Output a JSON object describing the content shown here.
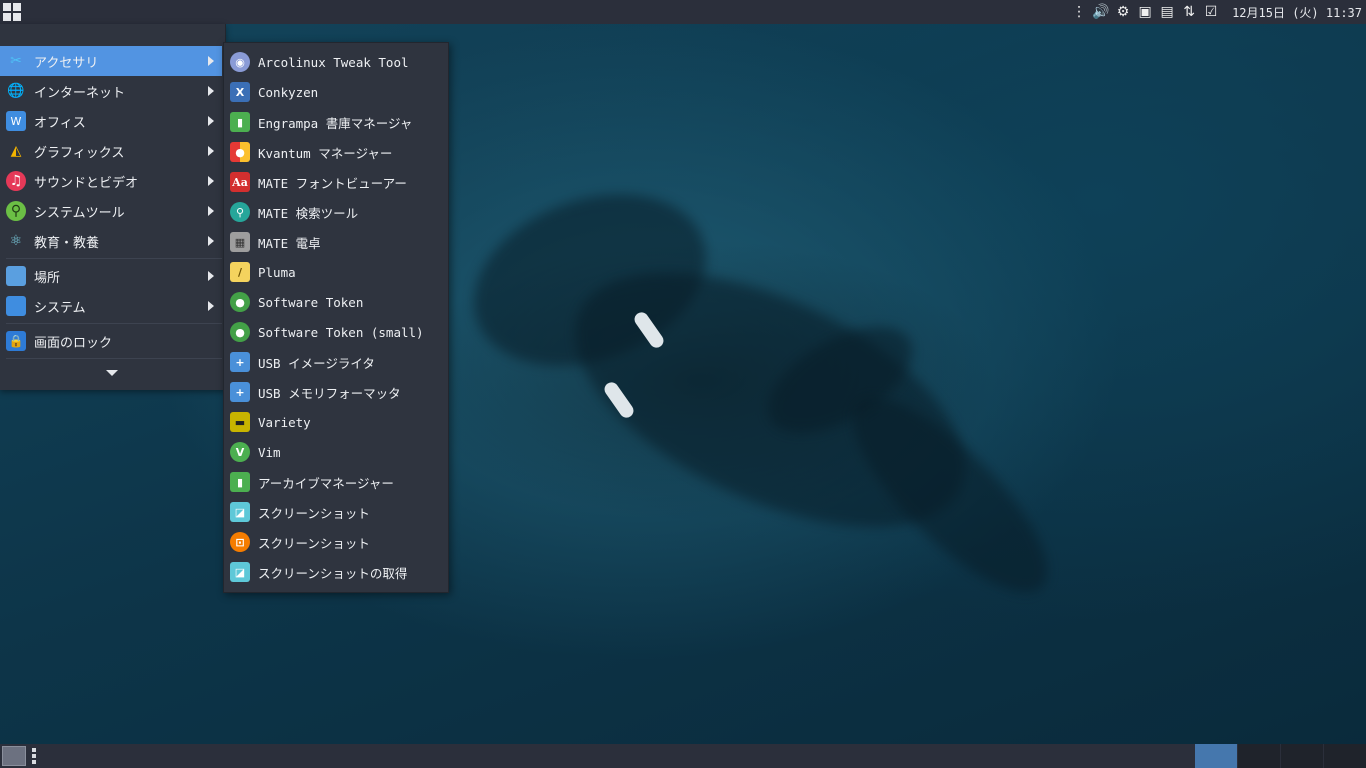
{
  "top_panel": {
    "clock": "12月15日 (火) 11:37",
    "tray_icons": [
      "panel-handle-icon",
      "volume-icon",
      "settings-gear-icon",
      "screenshot-icon",
      "clipboard-icon",
      "network-icon",
      "tasks-check-icon"
    ]
  },
  "menu": {
    "categories": [
      {
        "label": "アクセサリ",
        "icon": "accessories-icon",
        "active": true
      },
      {
        "label": "インターネット",
        "icon": "internet-icon"
      },
      {
        "label": "オフィス",
        "icon": "office-icon"
      },
      {
        "label": "グラフィックス",
        "icon": "graphics-icon"
      },
      {
        "label": "サウンドとビデオ",
        "icon": "sound-video-icon"
      },
      {
        "label": "システムツール",
        "icon": "system-tools-icon"
      },
      {
        "label": "教育・教養",
        "icon": "education-icon"
      },
      {
        "label": "場所",
        "icon": "places-folder-icon"
      },
      {
        "label": "システム",
        "icon": "system-monitor-icon"
      },
      {
        "label": "画面のロック",
        "icon": "lock-icon"
      }
    ]
  },
  "submenu": {
    "items": [
      {
        "label": "Arcolinux Tweak Tool",
        "icon": "tweak-tool-icon",
        "color": "#8a9bd6"
      },
      {
        "label": "Conkyzen",
        "icon": "conkyzen-icon",
        "color": "#3b6fb6"
      },
      {
        "label": "Engrampa 書庫マネージャ",
        "icon": "archive-manager-icon",
        "color": "#4caf50"
      },
      {
        "label": "Kvantum マネージャー",
        "icon": "kvantum-icon",
        "color": "#f0c020"
      },
      {
        "label": "MATE フォントビューアー",
        "icon": "font-viewer-icon",
        "color": "#d32f2f"
      },
      {
        "label": "MATE 検索ツール",
        "icon": "search-tool-icon",
        "color": "#26a69a"
      },
      {
        "label": "MATE 電卓",
        "icon": "calculator-icon",
        "color": "#9e9e9e"
      },
      {
        "label": "Pluma",
        "icon": "text-editor-icon",
        "color": "#f4d35e"
      },
      {
        "label": "Software Token",
        "icon": "software-token-icon",
        "color": "#43a047"
      },
      {
        "label": "Software Token (small)",
        "icon": "software-token-small-icon",
        "color": "#43a047"
      },
      {
        "label": "USB イメージライタ",
        "icon": "usb-image-writer-icon",
        "color": "#4a90d9"
      },
      {
        "label": "USB メモリフォーマッタ",
        "icon": "usb-formatter-icon",
        "color": "#4a90d9"
      },
      {
        "label": "Variety",
        "icon": "variety-icon",
        "color": "#c8b400"
      },
      {
        "label": "Vim",
        "icon": "vim-icon",
        "color": "#4caf50"
      },
      {
        "label": "アーカイブマネージャー",
        "icon": "archive-manager-2-icon",
        "color": "#4caf50"
      },
      {
        "label": "スクリーンショット",
        "icon": "screenshot-tool-icon",
        "color": "#5ec8d8"
      },
      {
        "label": "スクリーンショット",
        "icon": "screenshot-orange-icon",
        "color": "#f57c00"
      },
      {
        "label": "スクリーンショットの取得",
        "icon": "take-screenshot-icon",
        "color": "#5ec8d8"
      }
    ]
  }
}
